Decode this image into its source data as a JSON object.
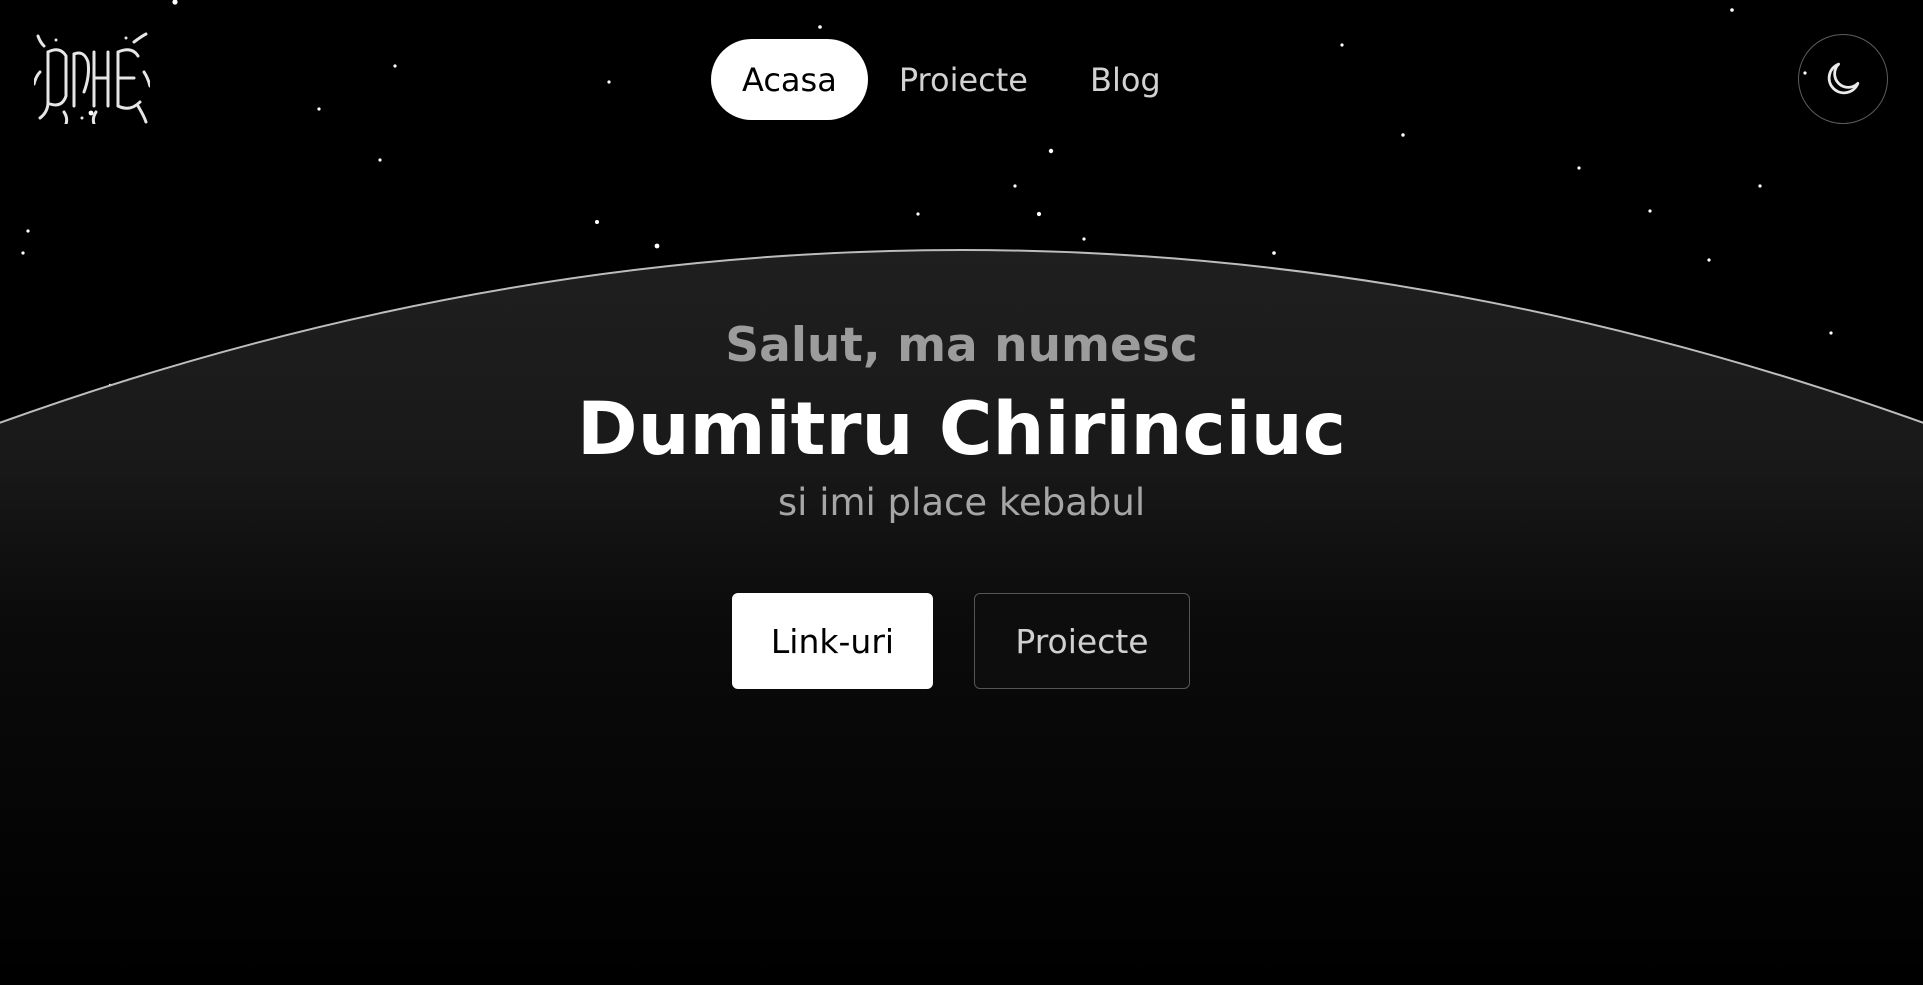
{
  "header": {
    "logo_alt": "logo",
    "nav": {
      "items": [
        {
          "label": "Acasa",
          "active": true
        },
        {
          "label": "Proiecte",
          "active": false
        },
        {
          "label": "Blog",
          "active": false
        }
      ]
    },
    "theme_toggle": {
      "icon": "moon-icon"
    }
  },
  "hero": {
    "greeting": "Salut, ma numesc",
    "name": "Dumitru Chirinciuc",
    "tagline": "si imi place kebabul",
    "buttons": {
      "primary_label": "Link-uri",
      "secondary_label": "Proiecte"
    }
  },
  "colors": {
    "background": "#000000",
    "planet_top": "#1e1e1e",
    "planet_rim": "#bdbdbd",
    "accent": "#ffffff",
    "muted_text": "#9c9c9c"
  }
}
